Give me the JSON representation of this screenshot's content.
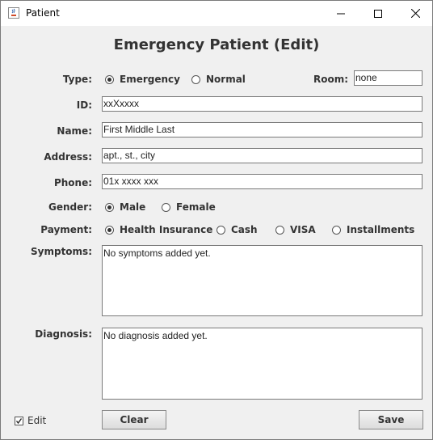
{
  "window": {
    "title": "Patient"
  },
  "heading": "Emergency Patient (Edit)",
  "type": {
    "label": "Type:",
    "options": [
      "Emergency",
      "Normal"
    ],
    "selected": "Emergency"
  },
  "room": {
    "label": "Room:",
    "value": "none"
  },
  "id": {
    "label": "ID:",
    "value": "xxXxxxx"
  },
  "name": {
    "label": "Name:",
    "value": "First Middle Last"
  },
  "address": {
    "label": "Address:",
    "value": "apt., st., city"
  },
  "phone": {
    "label": "Phone:",
    "value": "01x xxxx xxx"
  },
  "gender": {
    "label": "Gender:",
    "options": [
      "Male",
      "Female"
    ],
    "selected": "Male"
  },
  "payment": {
    "label": "Payment:",
    "options": [
      "Health Insurance",
      "Cash",
      "VISA",
      "Installments"
    ],
    "selected": "Health Insurance"
  },
  "symptoms": {
    "label": "Symptoms:",
    "value": "No symptoms added yet."
  },
  "diagnosis": {
    "label": "Diagnosis:",
    "value": "No diagnosis added yet."
  },
  "edit": {
    "label": "Edit",
    "checked": true
  },
  "buttons": {
    "clear": "Clear",
    "save": "Save"
  }
}
